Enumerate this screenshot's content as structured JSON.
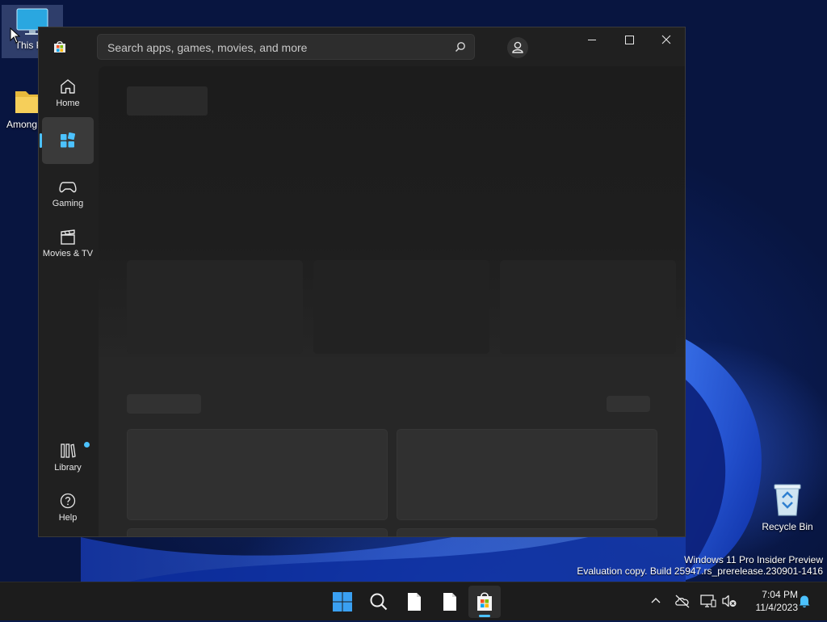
{
  "desktop": {
    "icons": [
      {
        "label": "This PC",
        "icon": "monitor-icon"
      },
      {
        "label": "Among...",
        "icon": "folder-icon"
      },
      {
        "label": "Recycle Bin",
        "icon": "recycle-bin-icon"
      }
    ],
    "watermark": {
      "line1": "Windows 11 Pro Insider Preview",
      "line2": "Evaluation copy. Build 25947.rs_prerelease.230901-1416"
    }
  },
  "window": {
    "search": {
      "placeholder": "Search apps, games, movies, and more"
    },
    "nav": [
      {
        "label": "Home",
        "icon": "home-icon"
      },
      {
        "label": "",
        "icon": "apps-icon",
        "active": true
      },
      {
        "label": "Gaming",
        "icon": "gamepad-icon"
      },
      {
        "label": "Movies & TV",
        "icon": "clapperboard-icon"
      },
      {
        "label": "Library",
        "icon": "library-icon",
        "badge": true
      },
      {
        "label": "Help",
        "icon": "help-icon"
      }
    ],
    "controls": [
      "minimize",
      "maximize",
      "close"
    ],
    "accent": "#4cc2ff"
  },
  "taskbar": {
    "apps": [
      "start-icon",
      "search-icon",
      "file-icon",
      "file-icon",
      "store-icon"
    ],
    "tray": {
      "time": "7:04 PM",
      "date": "11/4/2023"
    }
  }
}
